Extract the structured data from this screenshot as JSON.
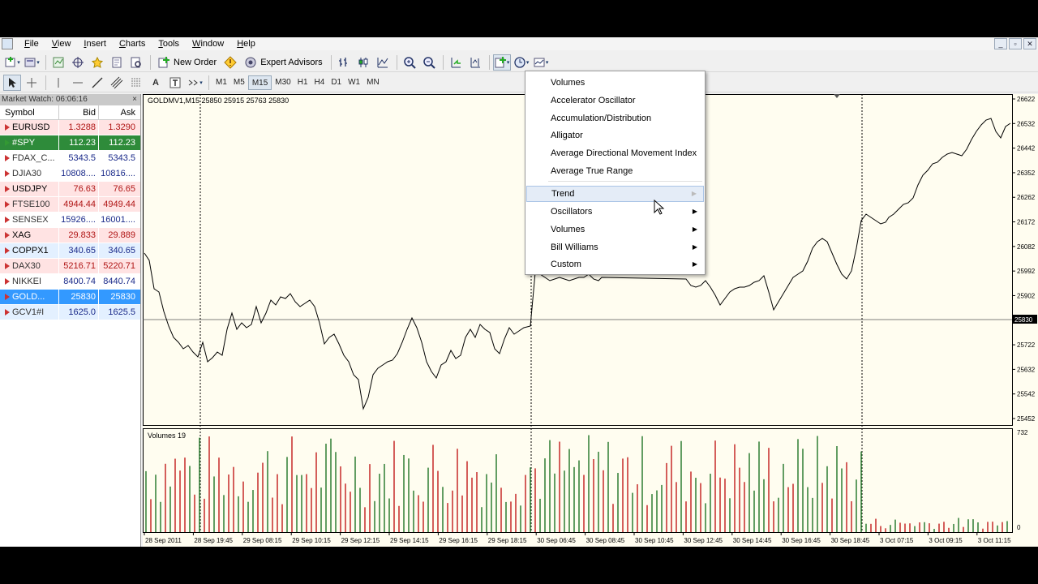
{
  "menu": {
    "items": [
      "File",
      "View",
      "Insert",
      "Charts",
      "Tools",
      "Window",
      "Help"
    ]
  },
  "toolbar": {
    "new_order_label": "New Order",
    "expert_advisors_label": "Expert Advisors"
  },
  "timeframes": [
    "M1",
    "M5",
    "M15",
    "M30",
    "H1",
    "H4",
    "D1",
    "W1",
    "MN"
  ],
  "active_timeframe": "M15",
  "market_watch": {
    "title": "Market Watch: 06:06:16",
    "close": "×",
    "columns": {
      "symbol": "Symbol",
      "bid": "Bid",
      "ask": "Ask"
    },
    "rows": [
      {
        "symbol": "EURUSD",
        "bid": "1.3288",
        "ask": "1.3290",
        "dir": "down",
        "bg": "#ffe3e3",
        "fg": "#000000"
      },
      {
        "symbol": "#SPY",
        "bid": "112.23",
        "ask": "112.23",
        "dir": "up",
        "bg": "#2e8b3a",
        "fg": "#ffffff"
      },
      {
        "symbol": "FDAX_C...",
        "bid": "5343.5",
        "ask": "5343.5",
        "dir": "down",
        "bg": "#ffffff",
        "fg": "#333333"
      },
      {
        "symbol": "DJIA30",
        "bid": "10808....",
        "ask": "10816....",
        "dir": "down",
        "bg": "#ffffff",
        "fg": "#333333"
      },
      {
        "symbol": "USDJPY",
        "bid": "76.63",
        "ask": "76.65",
        "dir": "down",
        "bg": "#ffe3e3",
        "fg": "#000000"
      },
      {
        "symbol": "FTSE100",
        "bid": "4944.44",
        "ask": "4949.44",
        "dir": "down",
        "bg": "#ffe3e3",
        "fg": "#333333"
      },
      {
        "symbol": "SENSEX",
        "bid": "15926....",
        "ask": "16001....",
        "dir": "down",
        "bg": "#ffffff",
        "fg": "#333333"
      },
      {
        "symbol": "XAG",
        "bid": "29.833",
        "ask": "29.889",
        "dir": "down",
        "bg": "#ffe3e3",
        "fg": "#000000"
      },
      {
        "symbol": "COPPX1",
        "bid": "340.65",
        "ask": "340.65",
        "dir": "down",
        "bg": "#e3f0ff",
        "fg": "#000000"
      },
      {
        "symbol": "DAX30",
        "bid": "5216.71",
        "ask": "5220.71",
        "dir": "down",
        "bg": "#ffe3e3",
        "fg": "#333333"
      },
      {
        "symbol": "NIKKEI",
        "bid": "8400.74",
        "ask": "8440.74",
        "dir": "down",
        "bg": "#ffffff",
        "fg": "#333333"
      },
      {
        "symbol": "GOLD...",
        "bid": "25830",
        "ask": "25830",
        "dir": "down",
        "bg": "#3399ff",
        "fg": "#ffffff"
      },
      {
        "symbol": "GCV1#I",
        "bid": "1625.0",
        "ask": "1625.5",
        "dir": "down",
        "bg": "#e3f0ff",
        "fg": "#333333"
      }
    ]
  },
  "chart": {
    "title": "GOLDMV1,M15  25850 25915 25763 25830",
    "volume_title": "Volumes 19",
    "price_ticks": [
      "26622",
      "26532",
      "26442",
      "26352",
      "26262",
      "26172",
      "26082",
      "25992",
      "25902",
      "25812",
      "25722",
      "25632",
      "25542",
      "25452"
    ],
    "current_price": "25830",
    "volume_ticks": [
      "732",
      "0"
    ],
    "time_ticks": [
      "28 Sep 2011",
      "28 Sep 19:45",
      "29 Sep 08:15",
      "29 Sep 10:15",
      "29 Sep 12:15",
      "29 Sep 14:15",
      "29 Sep 16:15",
      "29 Sep 18:15",
      "30 Sep 06:45",
      "30 Sep 08:45",
      "30 Sep 10:45",
      "30 Sep 12:45",
      "30 Sep 14:45",
      "30 Sep 16:45",
      "30 Sep 18:45",
      "3 Oct 07:15",
      "3 Oct 09:15",
      "3 Oct 11:15"
    ],
    "colors": {
      "background": "#fffdf0",
      "line": "#000000",
      "volume_up": "#2e7d32",
      "volume_down": "#c62828"
    }
  },
  "indicators_menu": {
    "items": [
      {
        "label": "Volumes",
        "submenu": false
      },
      {
        "label": "Accelerator Oscillator",
        "submenu": false
      },
      {
        "label": "Accumulation/Distribution",
        "submenu": false
      },
      {
        "label": "Alligator",
        "submenu": false
      },
      {
        "label": "Average Directional Movement Index",
        "submenu": false
      },
      {
        "label": "Average True Range",
        "submenu": false
      },
      {
        "label": "Trend",
        "submenu": true,
        "highlighted": true
      },
      {
        "label": "Oscillators",
        "submenu": true
      },
      {
        "label": "Volumes",
        "submenu": true
      },
      {
        "label": "Bill Williams",
        "submenu": true
      },
      {
        "label": "Custom",
        "submenu": true
      }
    ]
  }
}
